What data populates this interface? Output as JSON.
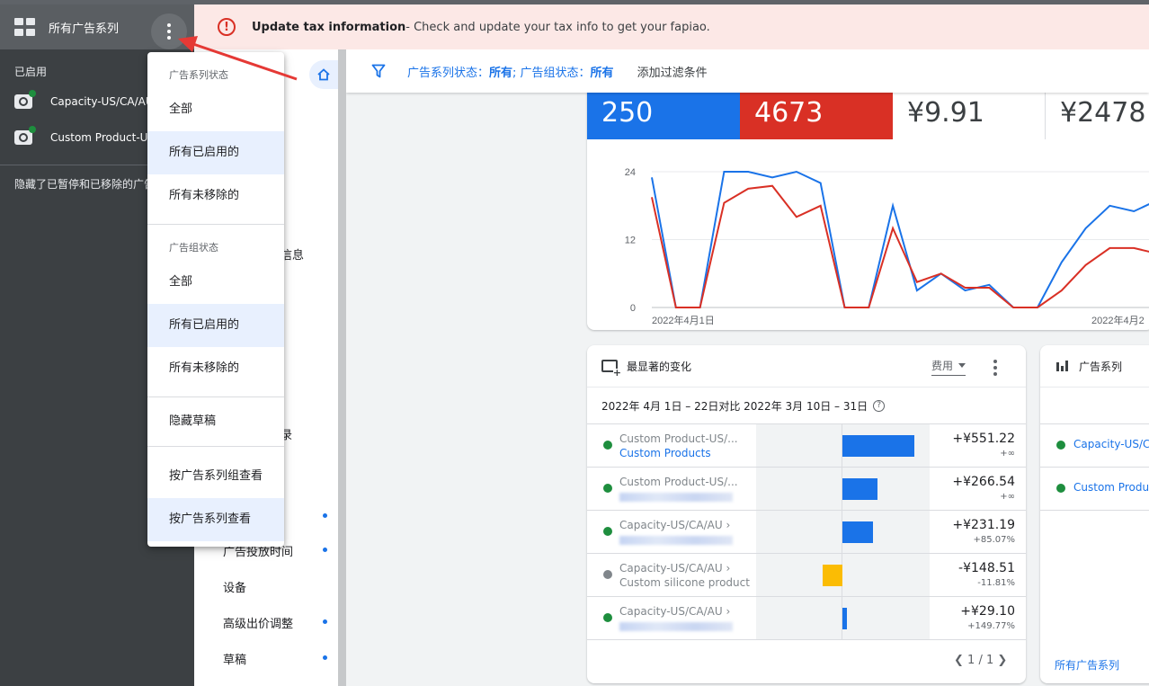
{
  "sidebar": {
    "title": "所有广告系列",
    "enabled_label": "已启用",
    "campaigns": [
      {
        "name": "Capacity-US/CA/AU"
      },
      {
        "name": "Custom Product-US"
      }
    ],
    "hidden_note": "隐藏了已暂停和已移除的广告系列"
  },
  "banner": {
    "title": "Update tax information",
    "message": " - Check and update your tax info to get your fapiao."
  },
  "nav": {
    "partial_1": "信息",
    "partial_2": "录",
    "partial_3": "广告投放时间",
    "item_devices": "设备",
    "item_bid_adjust": "高级出价调整",
    "item_drafts": "草稿"
  },
  "filter": {
    "campaign_status_label": "广告系列状态：",
    "campaign_status_value": "所有",
    "adgroup_status_label": "; 广告组状态：",
    "adgroup_status_value": "所有",
    "add_filter": "添加过滤条件"
  },
  "metrics": {
    "clicks": "250",
    "impressions": "4673",
    "avg_cpc": "¥9.91",
    "cost": "¥2478"
  },
  "chart_data": {
    "type": "line",
    "y_ticks": [
      "24",
      "12",
      "0"
    ],
    "ylim": [
      0,
      24
    ],
    "x_ticks": [
      "2022年4月1日",
      "2022年4月2"
    ],
    "series": [
      {
        "color": "#1a73e8",
        "values": [
          23,
          0,
          0,
          24,
          24,
          23,
          24,
          22,
          0,
          0,
          18,
          3,
          6,
          3,
          4,
          0,
          0,
          8,
          14,
          18,
          17,
          19
        ]
      },
      {
        "color": "#d93025",
        "values": [
          19.5,
          0,
          0,
          18.5,
          21,
          21.5,
          16,
          18,
          0,
          0,
          14,
          4.5,
          6,
          3.5,
          3.5,
          0,
          0,
          3,
          7.5,
          10.5,
          10.5,
          9.5
        ]
      }
    ]
  },
  "changes": {
    "title": "最显著的变化",
    "metric": "费用",
    "date_range": "2022年 4月 1日 – 22日对比 2022年 3月 10日 – 31日",
    "rows": [
      {
        "line1": "Custom Product-US/...",
        "line2": "Custom Products",
        "value": "+¥551.22",
        "pct": "+∞",
        "bar": 551.22
      },
      {
        "line1": "Custom Product-US/...",
        "line2": "",
        "value": "+¥266.54",
        "pct": "+∞",
        "bar": 266.54
      },
      {
        "line1": "Capacity-US/CA/AU ›",
        "line2": "",
        "value": "+¥231.19",
        "pct": "+85.07%",
        "bar": 231.19
      },
      {
        "line1": "Capacity-US/CA/AU ›",
        "line2": "Custom silicone product",
        "value": "-¥148.51",
        "pct": "-11.81%",
        "bar": -148.51
      },
      {
        "line1": "Capacity-US/CA/AU ›",
        "line2": "",
        "value": "+¥29.10",
        "pct": "+149.77%",
        "bar": 29.1
      }
    ],
    "pager": "1 / 1"
  },
  "campaigns_card": {
    "title": "广告系列",
    "rows": [
      {
        "name": "Capacity-US/CA/AU"
      },
      {
        "name": "Custom Product-US"
      }
    ],
    "all_link": "所有广告系列"
  },
  "menu": {
    "campaign_status_header": "广告系列状态",
    "adgroup_status_header": "广告组状态",
    "item_all_1": "全部",
    "item_enabled_1": "所有已启用的",
    "item_not_removed_1": "所有未移除的",
    "item_all_2": "全部",
    "item_enabled_2": "所有已启用的",
    "item_not_removed_2": "所有未移除的",
    "hide_drafts": "隐藏草稿",
    "view_by_group": "按广告系列组查看",
    "view_by_campaign": "按广告系列查看"
  },
  "colors": {
    "primary": "#1a73e8",
    "error": "#d93025",
    "enabled": "#1e8e3e",
    "warning_bar": "#fbbc04"
  }
}
